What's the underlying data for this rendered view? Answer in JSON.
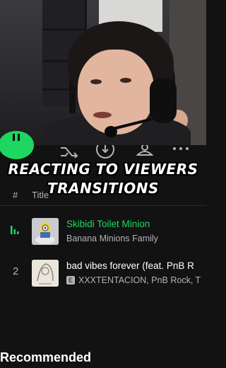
{
  "overlay": {
    "line1": "REACTING TO VIEWERS",
    "line2": "TRANSITIONS"
  },
  "header": {
    "hash": "#",
    "title": "Title"
  },
  "tracks": [
    {
      "number": "",
      "playing": true,
      "title": "Skibidi Toilet Minion",
      "artist": "Banana Minions Family",
      "explicit": false,
      "title_color": "#1ed760"
    },
    {
      "number": "2",
      "playing": false,
      "title": "bad vibes forever (feat. PnB R",
      "explicit_label": "E",
      "artist": "XXXTENTACION, PnB Rock, T",
      "explicit": true,
      "title_color": "#ffffff"
    }
  ],
  "section": {
    "recommended": "Recommended"
  },
  "icons": [
    "pause-icon",
    "shuffle-icon",
    "download-icon",
    "add-user-icon",
    "more-icon",
    "equalizer-icon"
  ],
  "colors": {
    "accent": "#1ed760",
    "background": "#121212",
    "secondary_text": "#b3b3b3"
  }
}
